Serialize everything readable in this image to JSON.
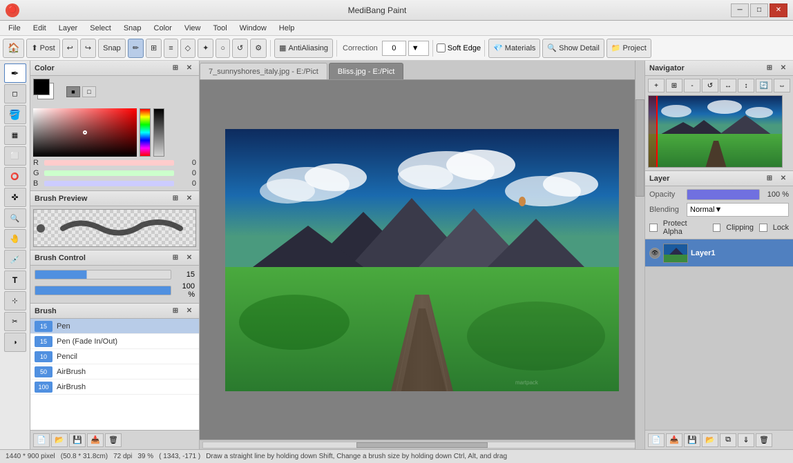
{
  "app": {
    "title": "MediBang Paint",
    "icon": "🔴"
  },
  "titlebar": {
    "title": "MediBang Paint",
    "minimize": "─",
    "maximize": "□",
    "close": "✕"
  },
  "menubar": {
    "items": [
      "File",
      "Edit",
      "Layer",
      "Select",
      "Snap",
      "Color",
      "View",
      "Tool",
      "Window",
      "Help"
    ]
  },
  "toolbar": {
    "post_label": "Post",
    "snap_label": "Snap",
    "antialias_label": "AntiAliasing",
    "correction_label": "Correction",
    "correction_value": "0",
    "soft_edge_label": "Soft Edge",
    "materials_label": "Materials",
    "show_detail_label": "Show Detail",
    "project_label": "Project"
  },
  "panels": {
    "color": {
      "title": "Color",
      "r_label": "R",
      "g_label": "G",
      "b_label": "B",
      "r_val": "0",
      "g_val": "0",
      "b_val": "0"
    },
    "brush_preview": {
      "title": "Brush Preview"
    },
    "brush_control": {
      "title": "Brush Control",
      "size_val": "15",
      "opacity_val": "100 %"
    },
    "brush": {
      "title": "Brush",
      "items": [
        {
          "size": "15",
          "name": "Pen",
          "active": true
        },
        {
          "size": "15",
          "name": "Pen (Fade In/Out)",
          "active": false
        },
        {
          "size": "10",
          "name": "Pencil",
          "active": false
        },
        {
          "size": "50",
          "name": "AirBrush",
          "active": false
        },
        {
          "size": "100",
          "name": "AirBrush",
          "active": false
        }
      ]
    },
    "navigator": {
      "title": "Navigator"
    },
    "layer": {
      "title": "Layer",
      "opacity_label": "Opacity",
      "opacity_val": "100 %",
      "blending_label": "Blending",
      "blending_val": "Normal",
      "protect_alpha": "Protect Alpha",
      "clipping": "Clipping",
      "lock": "Lock",
      "items": [
        {
          "name": "Layer1",
          "visible": true,
          "active": true
        }
      ]
    }
  },
  "tabs": [
    {
      "label": "7_sunnyshores_italy.jpg - E:/Pict",
      "active": false
    },
    {
      "label": "Bliss.jpg - E:/Pict",
      "active": true
    }
  ],
  "statusbar": {
    "size": "1440 * 900 pixel",
    "cm": "(50.8 * 31.8cm)",
    "dpi": "72 dpi",
    "zoom": "39 %",
    "coords": "( 1343, -171 )",
    "hint": "Draw a straight line by holding down Shift, Change a brush size by holding down Ctrl, Alt, and drag"
  }
}
